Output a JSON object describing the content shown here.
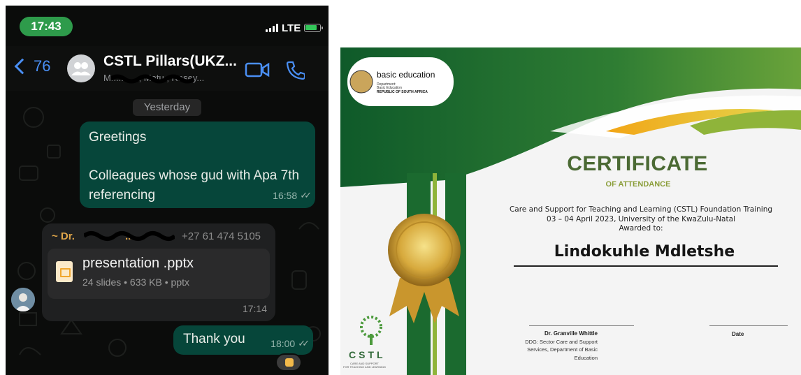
{
  "chat": {
    "status": {
      "time": "17:43",
      "network": "LTE"
    },
    "header": {
      "back_count": "76",
      "title": "CSTL Pillars(UKZ...",
      "subtitle": "Mr.........., Matu , Rasey..."
    },
    "date_divider": "Yesterday",
    "messages": [
      {
        "direction": "outgoing",
        "line1": "Greetings",
        "line2": "Colleagues whose gud with Apa 7th referencing",
        "time": "16:58"
      },
      {
        "direction": "incoming",
        "sender": "~ Dr.",
        "sender_tail": "....",
        "phone": "+27 61 474 5105",
        "file_name": "presentation .pptx",
        "file_meta": "24 slides • 633 KB • pptx",
        "time": "17:14"
      },
      {
        "direction": "outgoing",
        "text": "Thank you",
        "time": "18:00",
        "reaction": "thumbs-up"
      }
    ]
  },
  "certificate": {
    "logo": {
      "name": "basic education",
      "line1": "Department:",
      "line2": "Basic Education",
      "line3": "REPUBLIC OF SOUTH AFRICA"
    },
    "title": "CERTIFICATE",
    "subtitle": "OF ATTENDANCE",
    "desc_line1": "Care and Support for Teaching and Learning (CSTL) Foundation Training",
    "desc_line2": "03 – 04 April 2023, University of the KwaZulu-Natal",
    "desc_line3": "Awarded to:",
    "recipient": "Lindokuhle Mdletshe",
    "signatory": {
      "name": "Dr. Granville Whittle",
      "role1": "DDG: Sector Care and Support",
      "role2": "Services, Department of Basic",
      "role3": "Education"
    },
    "date_label": "Date",
    "cstl": {
      "name": "CSTL",
      "tag1": "CARE AND SUPPORT",
      "tag2": "FOR TEACHING AND LEARNING"
    }
  },
  "colors": {
    "chat_bg": "#0b0c0b",
    "outgoing_bubble": "#06463a",
    "incoming_bubble": "#1f2021",
    "accent_blue": "#4a8ff4",
    "cert_green": "#4b6a34",
    "cert_gold": "#d4a93a"
  }
}
